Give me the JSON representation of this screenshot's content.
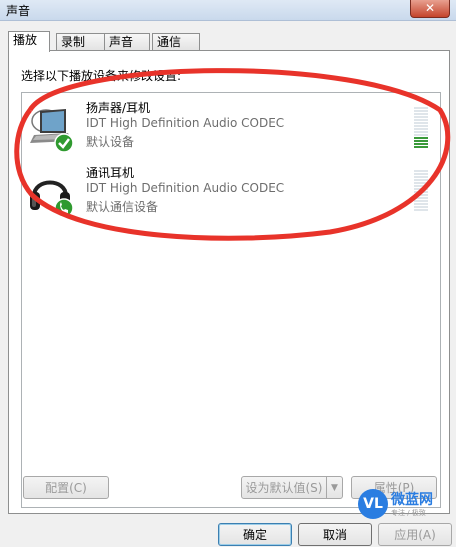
{
  "window": {
    "title": "声音",
    "close_label": "✕"
  },
  "tabs": [
    {
      "label": "播放",
      "active": true
    },
    {
      "label": "录制",
      "active": false
    },
    {
      "label": "声音",
      "active": false
    },
    {
      "label": "通信",
      "active": false
    }
  ],
  "instruction": "选择以下播放设备来修改设置:",
  "devices": [
    {
      "name": "扬声器/耳机",
      "description": "IDT High Definition Audio CODEC",
      "status": "默认设备",
      "icon": "laptop-speaker-icon",
      "badge": "default-check-icon",
      "level_fraction": 0.3
    },
    {
      "name": "通讯耳机",
      "description": "IDT High Definition Audio CODEC",
      "status": "默认通信设备",
      "icon": "headphones-icon",
      "badge": "phone-badge-icon",
      "level_fraction": 0.0
    }
  ],
  "buttons": {
    "configure": "配置(C)",
    "set_default": "设为默认值(S)",
    "properties": "属性(P)",
    "ok": "确定",
    "cancel": "取消",
    "apply": "应用(A)"
  },
  "annotation": {
    "color": "#e8332a"
  },
  "watermark": {
    "badge": "VL",
    "main": "微蓝网",
    "sub": "专注 / 极致"
  }
}
